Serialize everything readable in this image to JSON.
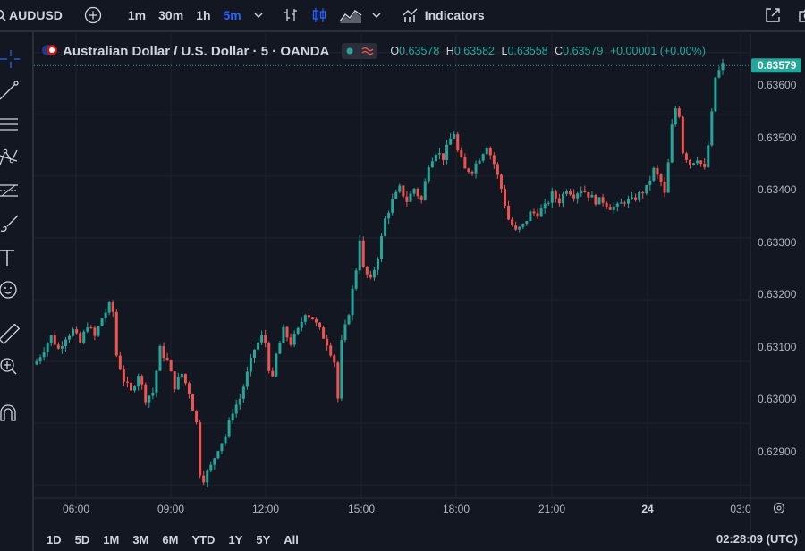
{
  "toolbar": {
    "symbol": "AUDUSD",
    "intervals": [
      {
        "label": "1m",
        "active": false
      },
      {
        "label": "30m",
        "active": false
      },
      {
        "label": "1h",
        "active": false
      },
      {
        "label": "5m",
        "active": true
      }
    ],
    "indicators_label": "Indicators"
  },
  "legend": {
    "title": "Australian Dollar / U.S. Dollar · 5 · OANDA",
    "open_key": "O",
    "open": "0.63578",
    "high_key": "H",
    "high": "0.63582",
    "low_key": "L",
    "low": "0.63558",
    "close_key": "C",
    "close": "0.63579",
    "change": "+0.00001 (+0.00%)"
  },
  "price_axis": {
    "labels": [
      "0.63600",
      "0.63500",
      "0.63400",
      "0.63300",
      "0.63200",
      "0.63100",
      "0.63000",
      "0.62900"
    ],
    "last_price": "0.63579"
  },
  "time_axis": {
    "labels": [
      "06:00",
      "09:00",
      "12:00",
      "15:00",
      "18:00",
      "21:00",
      "24",
      "03:0"
    ]
  },
  "bottom": {
    "ranges": [
      "1D",
      "5D",
      "1M",
      "3M",
      "6M",
      "YTD",
      "1Y",
      "5Y",
      "All"
    ],
    "clock": "02:28:09 (UTC)"
  },
  "colors": {
    "up": "#26a69a",
    "down": "#ef5350",
    "accent": "#2962ff",
    "bg": "#131722",
    "grid": "#1f2330"
  },
  "chart_data": {
    "type": "candlestick",
    "y_range": [
      0.6288,
      0.6363
    ],
    "last_price": 0.63579,
    "close_path": [
      [
        0,
        0.631
      ],
      [
        2,
        0.6312
      ],
      [
        4,
        0.6314
      ],
      [
        6,
        0.6312
      ],
      [
        8,
        0.6314
      ],
      [
        10,
        0.6315
      ],
      [
        12,
        0.6313
      ],
      [
        14,
        0.6316
      ],
      [
        16,
        0.6314
      ],
      [
        18,
        0.6317
      ],
      [
        20,
        0.6319
      ],
      [
        21,
        0.6318
      ],
      [
        22,
        0.6311
      ],
      [
        24,
        0.6307
      ],
      [
        26,
        0.6305
      ],
      [
        28,
        0.6308
      ],
      [
        30,
        0.6304
      ],
      [
        32,
        0.6305
      ],
      [
        34,
        0.6312
      ],
      [
        36,
        0.631
      ],
      [
        38,
        0.6306
      ],
      [
        40,
        0.6308
      ],
      [
        42,
        0.6305
      ],
      [
        44,
        0.63
      ],
      [
        45,
        0.6292
      ],
      [
        46,
        0.6291
      ],
      [
        48,
        0.6293
      ],
      [
        50,
        0.6296
      ],
      [
        52,
        0.6298
      ],
      [
        54,
        0.6302
      ],
      [
        56,
        0.6304
      ],
      [
        58,
        0.6308
      ],
      [
        60,
        0.6312
      ],
      [
        62,
        0.6314
      ],
      [
        63,
        0.6313
      ],
      [
        64,
        0.6309
      ],
      [
        65,
        0.6307
      ],
      [
        66,
        0.6311
      ],
      [
        68,
        0.6315
      ],
      [
        70,
        0.6313
      ],
      [
        72,
        0.6315
      ],
      [
        74,
        0.6318
      ],
      [
        76,
        0.6317
      ],
      [
        78,
        0.6315
      ],
      [
        80,
        0.6313
      ],
      [
        82,
        0.631
      ],
      [
        83,
        0.6304
      ],
      [
        84,
        0.6313
      ],
      [
        86,
        0.6318
      ],
      [
        88,
        0.6325
      ],
      [
        89,
        0.633
      ],
      [
        90,
        0.6325
      ],
      [
        92,
        0.6323
      ],
      [
        94,
        0.6327
      ],
      [
        96,
        0.6333
      ],
      [
        98,
        0.6336
      ],
      [
        100,
        0.6338
      ],
      [
        102,
        0.6336
      ],
      [
        104,
        0.6338
      ],
      [
        106,
        0.6336
      ],
      [
        108,
        0.6342
      ],
      [
        110,
        0.6344
      ],
      [
        112,
        0.6343
      ],
      [
        114,
        0.6346
      ],
      [
        115,
        0.6347
      ],
      [
        116,
        0.6344
      ],
      [
        118,
        0.6341
      ],
      [
        120,
        0.6341
      ],
      [
        122,
        0.6343
      ],
      [
        124,
        0.6345
      ],
      [
        126,
        0.6342
      ],
      [
        128,
        0.6338
      ],
      [
        130,
        0.6333
      ],
      [
        132,
        0.6331
      ],
      [
        134,
        0.6332
      ],
      [
        136,
        0.6334
      ],
      [
        138,
        0.6334
      ],
      [
        140,
        0.6335
      ],
      [
        142,
        0.6337
      ],
      [
        144,
        0.6336
      ],
      [
        146,
        0.6338
      ],
      [
        148,
        0.6337
      ],
      [
        150,
        0.6338
      ],
      [
        152,
        0.6337
      ],
      [
        154,
        0.6336
      ],
      [
        156,
        0.6336
      ],
      [
        158,
        0.6335
      ],
      [
        160,
        0.6335
      ],
      [
        162,
        0.6336
      ],
      [
        164,
        0.6336
      ],
      [
        166,
        0.6337
      ],
      [
        168,
        0.6338
      ],
      [
        170,
        0.6341
      ],
      [
        172,
        0.6339
      ],
      [
        173,
        0.6337
      ],
      [
        174,
        0.6342
      ],
      [
        175,
        0.6348
      ],
      [
        176,
        0.6351
      ],
      [
        177,
        0.635
      ],
      [
        178,
        0.6344
      ],
      [
        180,
        0.6342
      ],
      [
        182,
        0.6343
      ],
      [
        184,
        0.6341
      ],
      [
        185,
        0.6345
      ],
      [
        186,
        0.635
      ],
      [
        187,
        0.6356
      ],
      [
        188,
        0.6357
      ],
      [
        189,
        0.6358
      ]
    ]
  }
}
